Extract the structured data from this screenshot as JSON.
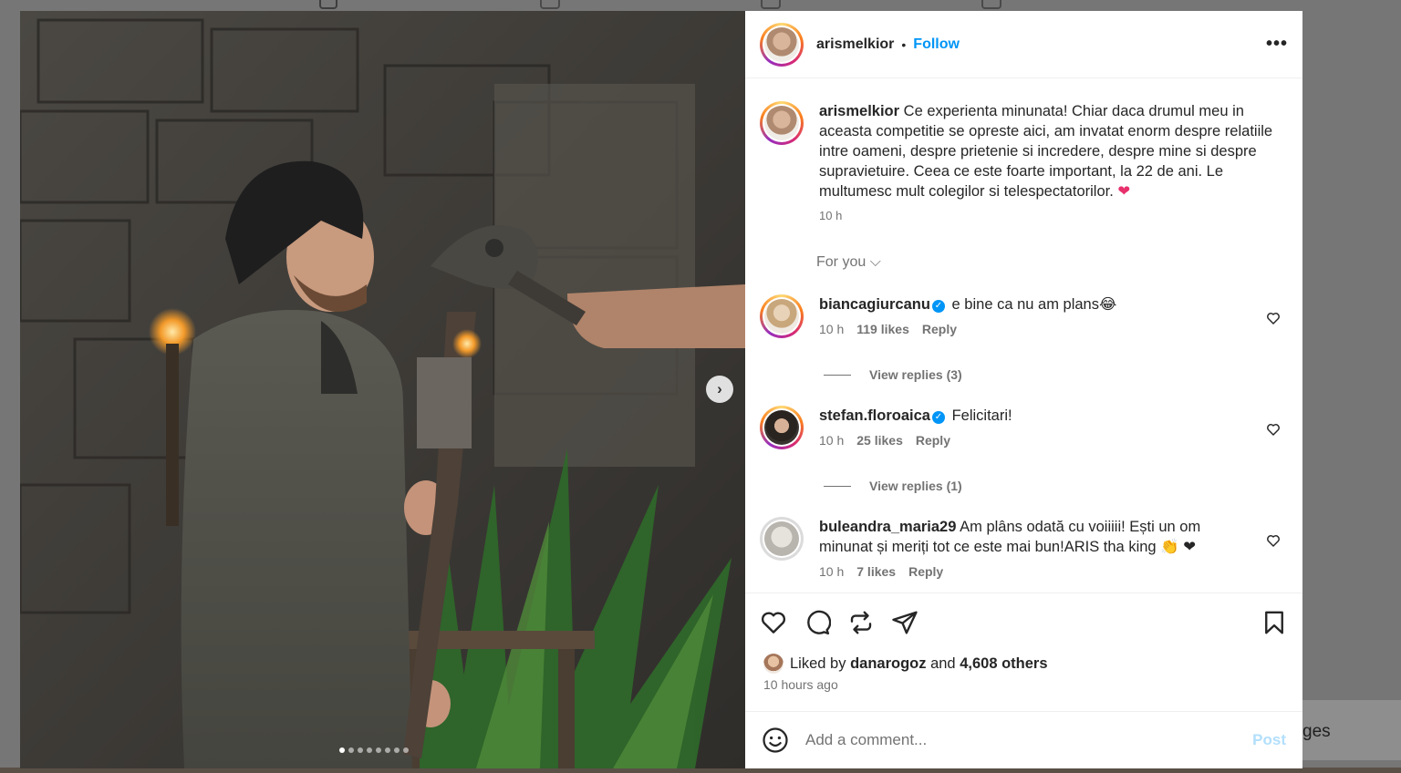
{
  "post": {
    "author": "arismelkior",
    "separator": "•",
    "follow_label": "Follow",
    "more_label": "•••",
    "caption_text": "Ce experienta minunata! Chiar daca drumul meu in aceasta competitie se opreste aici, am invatat enorm despre relatiile intre oameni, despre prietenie si incredere, despre mine si despre supravietuire. Ceea ce este foarte important, la 22 de ani. Le multumesc mult colegilor si telespectatorilor.",
    "caption_emoji": "❤",
    "caption_time": "10 h",
    "carousel_next": "›",
    "carousel_count": 8,
    "carousel_active": 0
  },
  "for_you_label": "For you ⌵",
  "comments": [
    {
      "username": "biancagiurcanu",
      "verified": true,
      "text": "e bine ca nu am plans😂",
      "time": "10 h",
      "likes": "119 likes",
      "reply": "Reply",
      "view_replies": "View replies (3)"
    },
    {
      "username": "stefan.floroaica",
      "verified": true,
      "text": "Felicitari!",
      "time": "10 h",
      "likes": "25 likes",
      "reply": "Reply",
      "view_replies": "View replies (1)"
    },
    {
      "username": "buleandra_maria29",
      "verified": false,
      "text": "Am plâns odată cu voiiiii! Ești un om minunat și meriți tot ce este mai bun!ARIS tha king 👏 ❤",
      "time": "10 h",
      "likes": "7 likes",
      "reply": "Reply"
    }
  ],
  "likes": {
    "prefix": "Liked by",
    "user": "danarogoz",
    "and": "and",
    "others": "4,608 others",
    "ago": "10 hours ago"
  },
  "add_comment": {
    "placeholder": "Add a comment...",
    "post_label": "Post"
  },
  "background": {
    "side_text": "ges"
  },
  "colors": {
    "accent": "#0095f6",
    "post_disabled": "#b2dffc",
    "like_red": "#e8306d"
  }
}
